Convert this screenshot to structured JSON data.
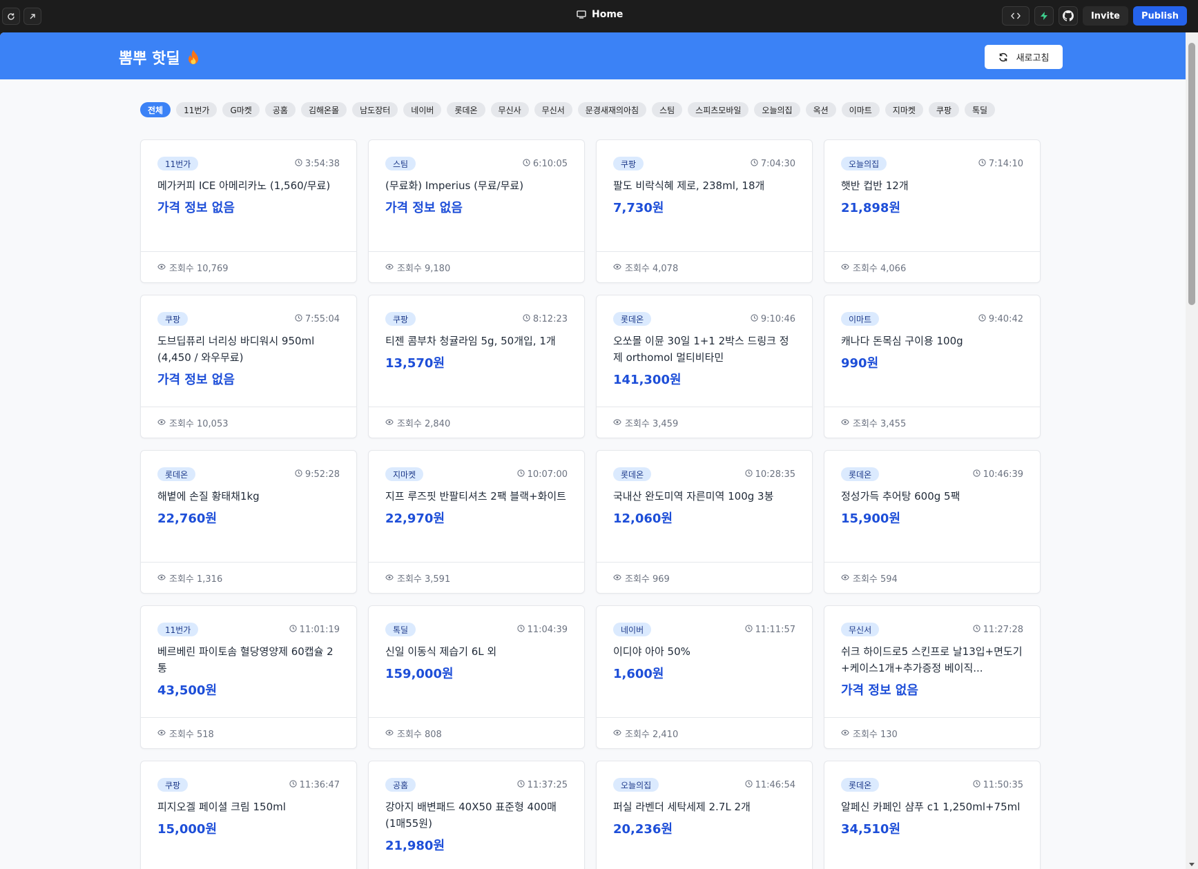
{
  "editor": {
    "title": "Home",
    "invite_label": "Invite",
    "publish_label": "Publish"
  },
  "app": {
    "brand": "뽐뿌 핫딜",
    "refresh_label": "새로고침",
    "colors": {
      "header": "#3b82f6",
      "price": "#1d4ed8",
      "badge_bg": "#dbeafe"
    }
  },
  "filters": [
    {
      "label": "전체",
      "active": true
    },
    {
      "label": "11번가"
    },
    {
      "label": "G마켓"
    },
    {
      "label": "공홈"
    },
    {
      "label": "김해온몰"
    },
    {
      "label": "남도장터"
    },
    {
      "label": "네이버"
    },
    {
      "label": "롯데온"
    },
    {
      "label": "무신사"
    },
    {
      "label": "무신서"
    },
    {
      "label": "문경새재의아침"
    },
    {
      "label": "스팀"
    },
    {
      "label": "스피츠모바일"
    },
    {
      "label": "오늘의집"
    },
    {
      "label": "옥션"
    },
    {
      "label": "이마트"
    },
    {
      "label": "지마켓"
    },
    {
      "label": "쿠팡"
    },
    {
      "label": "톡딜"
    }
  ],
  "deals": [
    {
      "store": "11번가",
      "time": "3:54:38",
      "title": "메가커피 ICE 아메리카노 (1,560/무료)",
      "price": "가격 정보 없음",
      "views": "조회수 10,769"
    },
    {
      "store": "스팀",
      "time": "6:10:05",
      "title": "(무료화) Imperius (무료/무료)",
      "price": "가격 정보 없음",
      "views": "조회수 9,180"
    },
    {
      "store": "쿠팡",
      "time": "7:04:30",
      "title": "팔도 비락식혜 제로, 238ml, 18개",
      "price": "7,730원",
      "views": "조회수 4,078"
    },
    {
      "store": "오늘의집",
      "time": "7:14:10",
      "title": "햇반 컵반 12개",
      "price": "21,898원",
      "views": "조회수 4,066"
    },
    {
      "store": "쿠팡",
      "time": "7:55:04",
      "title": "도브딥퓨리 너리싱 바디워시 950ml (4,450 / 와우무료)",
      "price": "가격 정보 없음",
      "views": "조회수 10,053"
    },
    {
      "store": "쿠팡",
      "time": "8:12:23",
      "title": "티젠 콤부차 청귤라임 5g, 50개입, 1개",
      "price": "13,570원",
      "views": "조회수 2,840"
    },
    {
      "store": "롯데온",
      "time": "9:10:46",
      "title": "오쏘몰 이뮨 30일 1+1 2박스 드링크 정제 orthomol 멀티비타민",
      "price": "141,300원",
      "views": "조회수 3,459"
    },
    {
      "store": "이마트",
      "time": "9:40:42",
      "title": "캐나다 돈목심 구이용 100g",
      "price": "990원",
      "views": "조회수 3,455"
    },
    {
      "store": "롯데온",
      "time": "9:52:28",
      "title": "해볕에 손질 황태채1kg",
      "price": "22,760원",
      "views": "조회수 1,316"
    },
    {
      "store": "지마켓",
      "time": "10:07:00",
      "title": "지프 루즈핏 반팔티셔츠 2팩 블랙+화이트",
      "price": "22,970원",
      "views": "조회수 3,591"
    },
    {
      "store": "롯데온",
      "time": "10:28:35",
      "title": "국내산 완도미역 자른미역 100g 3봉",
      "price": "12,060원",
      "views": "조회수 969"
    },
    {
      "store": "롯데온",
      "time": "10:46:39",
      "title": "정성가득 추어탕 600g 5팩",
      "price": "15,900원",
      "views": "조회수 594"
    },
    {
      "store": "11번가",
      "time": "11:01:19",
      "title": "베르베린 파이토솜 혈당영양제 60캡슐 2통",
      "price": "43,500원",
      "views": "조회수 518"
    },
    {
      "store": "톡딜",
      "time": "11:04:39",
      "title": "신일 이동식 제습기 6L 외",
      "price": "159,000원",
      "views": "조회수 808"
    },
    {
      "store": "네이버",
      "time": "11:11:57",
      "title": "이디야 아아 50%",
      "price": "1,600원",
      "views": "조회수 2,410"
    },
    {
      "store": "무신서",
      "time": "11:27:28",
      "title": "쉬크 하이드로5 스킨프로 날13입+면도기+케이스1개+추가증정 베이직...",
      "price": "가격 정보 없음",
      "views": "조회수 130"
    },
    {
      "store": "쿠팡",
      "time": "11:36:47",
      "title": "피지오겔 페이셜 크림 150ml",
      "price": "15,000원",
      "views": ""
    },
    {
      "store": "공홈",
      "time": "11:37:25",
      "title": "강아지 배변패드 40X50 표준형 400매 (1매55원)",
      "price": "21,980원",
      "views": ""
    },
    {
      "store": "오늘의집",
      "time": "11:46:54",
      "title": "퍼실 라벤더 세탁세제 2.7L 2개",
      "price": "20,236원",
      "views": ""
    },
    {
      "store": "롯데온",
      "time": "11:50:35",
      "title": "알페신 카페인 샴푸 c1 1,250ml+75ml",
      "price": "34,510원",
      "views": ""
    }
  ]
}
